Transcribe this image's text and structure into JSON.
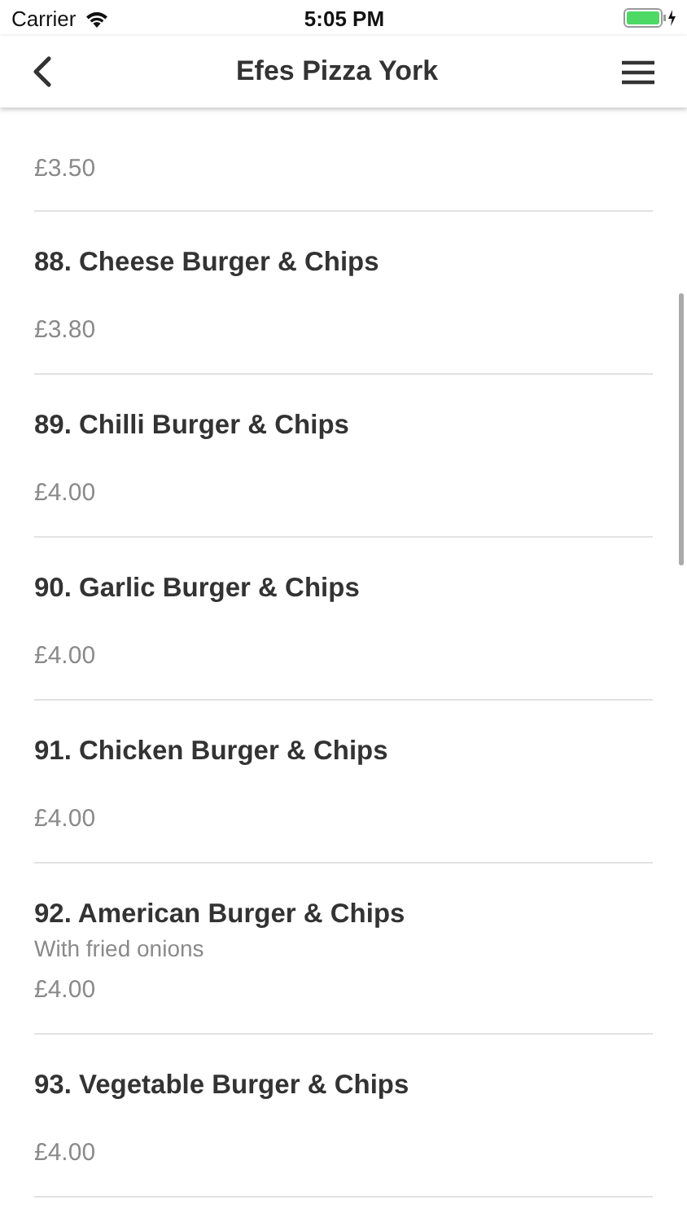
{
  "status_bar": {
    "carrier": "Carrier",
    "time": "5:05 PM"
  },
  "nav": {
    "title": "Efes Pizza York"
  },
  "items": [
    {
      "price": "£3.50"
    },
    {
      "title": "88. Cheese Burger & Chips",
      "price": "£3.80"
    },
    {
      "title": "89. Chilli Burger & Chips",
      "price": "£4.00"
    },
    {
      "title": "90. Garlic Burger & Chips",
      "price": "£4.00"
    },
    {
      "title": "91. Chicken Burger & Chips",
      "price": "£4.00"
    },
    {
      "title": "92. American Burger & Chips",
      "description": "With fried onions",
      "price": "£4.00"
    },
    {
      "title": "93. Vegetable Burger & Chips",
      "price": "£4.00"
    }
  ]
}
